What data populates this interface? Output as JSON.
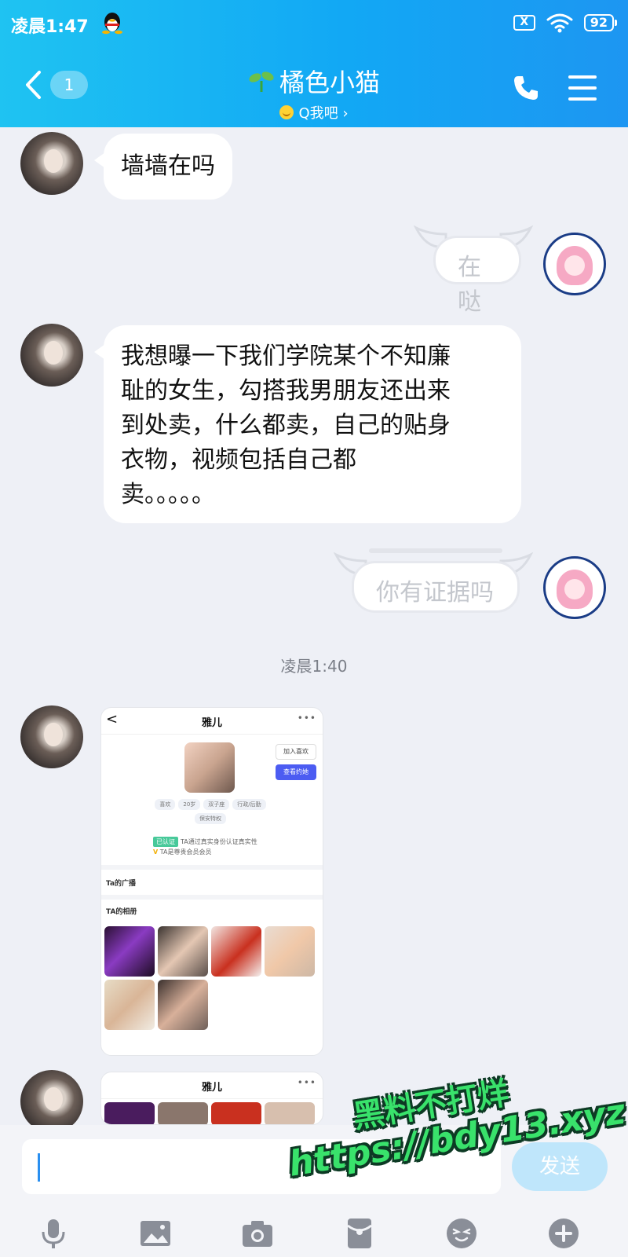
{
  "status_bar": {
    "time": "凌晨1:47",
    "sim_label": "X",
    "battery": "92"
  },
  "header": {
    "unread_count": "1",
    "contact_name": "橘色小猫",
    "subtitle": "Q我吧 ›"
  },
  "messages": [
    {
      "side": "left",
      "text": "墙墙在吗"
    },
    {
      "side": "right",
      "text": "在哒"
    },
    {
      "side": "left",
      "lines": [
        "我想曝一下我们学院某个不知廉",
        "耻的女生，勾搭我男朋友还出来",
        "到处卖，什么都卖，自己的贴身",
        "衣物，视频包括自己都",
        "卖。。。。。"
      ]
    },
    {
      "side": "right",
      "text": "你有证据吗"
    }
  ],
  "timestamp": "凌晨1:40",
  "shared_card": {
    "back": "<",
    "title": "雅儿",
    "more": "•••",
    "add_button": "加入喜欢",
    "chat_button": "查看约她",
    "tags": [
      "喜欢",
      "20岁",
      "双子座",
      "行政/后勤",
      "保安特权"
    ],
    "verify_badge": "已认证",
    "verify_text": "TA通过真实身份认证真实性",
    "vip_mark": "V",
    "vip_text": "TA是尊贵会员会员",
    "section_broadcast": "Ta的广播",
    "section_album": "TA的相册"
  },
  "shared_card_2": {
    "title": "雅儿",
    "more": "•••"
  },
  "input": {
    "send_label": "发送"
  },
  "toolbar": [
    "mic-icon",
    "image-icon",
    "camera-icon",
    "red-packet-icon",
    "emoji-icon",
    "plus-icon"
  ],
  "watermark": {
    "line1": "黑料不打烊",
    "line2": "https://bdy13.xyz"
  }
}
